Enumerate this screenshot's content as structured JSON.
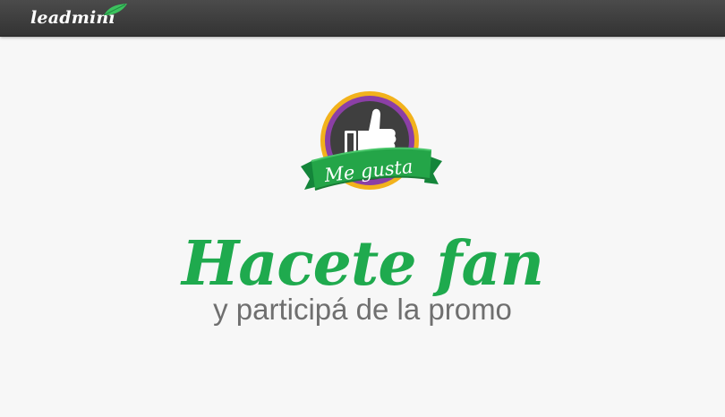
{
  "header": {
    "logo_text": "leadmini"
  },
  "badge": {
    "ribbon_text": "Me gusta",
    "icon": "thumbs-up-icon"
  },
  "hero": {
    "headline": "Hacete fan",
    "subline": "y participá de la promo"
  },
  "colors": {
    "topbar": "#3d3d3d",
    "brand_green": "#1faa4e",
    "badge_ring_outer": "#f2b21c",
    "badge_ring_inner": "#8b3fa6",
    "badge_core": "#3f3f3f",
    "subline_gray": "#6f6f6f"
  }
}
